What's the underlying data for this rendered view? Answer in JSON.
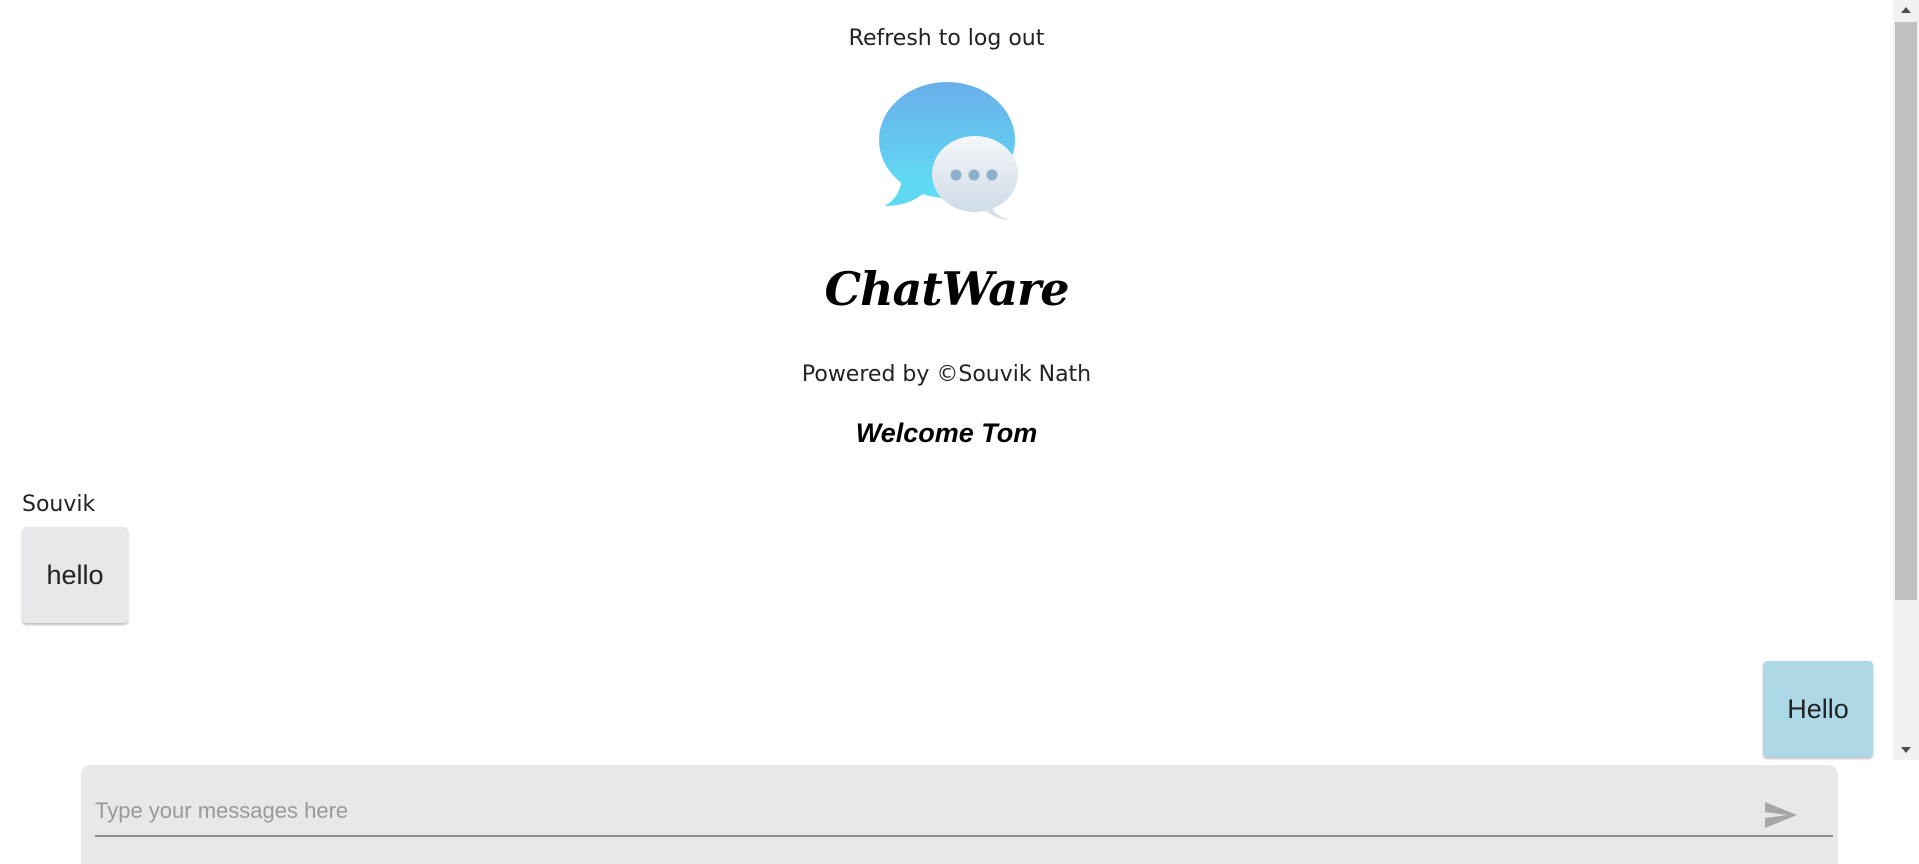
{
  "header": {
    "refresh_note": "Refresh to log out",
    "logo_icon": "chat-bubbles-icon",
    "app_title": "ChatWare",
    "powered_by": "Powered by ©Souvik Nath",
    "welcome": "Welcome Tom"
  },
  "messages": [
    {
      "sender": "Souvik",
      "text": "hello",
      "direction": "incoming"
    },
    {
      "sender": "",
      "text": "Hello",
      "direction": "outgoing"
    }
  ],
  "composer": {
    "placeholder": "Type your messages here",
    "value": "",
    "send_icon": "send-icon"
  },
  "colors": {
    "incoming_bubble": "#e8e8ea",
    "outgoing_bubble": "#add8e6",
    "composer_bg": "#e8e8ea"
  }
}
